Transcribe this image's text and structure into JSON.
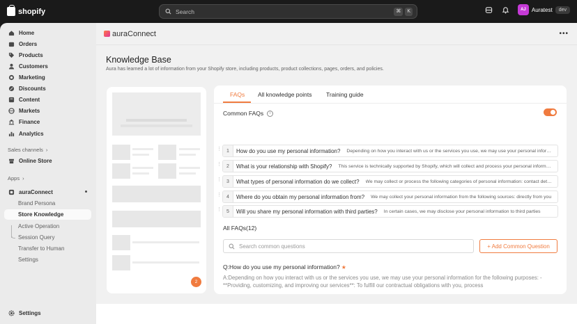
{
  "topbar": {
    "brand": "shopify",
    "search_placeholder": "Search",
    "shortcut_keys": [
      "⌘",
      "K"
    ],
    "store_initials": "AJ",
    "store_name": "Auratest",
    "store_tag": "dev"
  },
  "sidebar": {
    "items": [
      {
        "label": "Home",
        "icon": "home-icon"
      },
      {
        "label": "Orders",
        "icon": "orders-icon"
      },
      {
        "label": "Products",
        "icon": "tag-icon"
      },
      {
        "label": "Customers",
        "icon": "person-icon"
      },
      {
        "label": "Marketing",
        "icon": "target-icon"
      },
      {
        "label": "Discounts",
        "icon": "discount-icon"
      },
      {
        "label": "Content",
        "icon": "content-icon"
      },
      {
        "label": "Markets",
        "icon": "globe-icon"
      },
      {
        "label": "Finance",
        "icon": "bank-icon"
      },
      {
        "label": "Analytics",
        "icon": "chart-icon"
      }
    ],
    "sales_channels_label": "Sales channels",
    "online_store": "Online Store",
    "apps_label": "Apps",
    "app_name": "auraConnect",
    "app_subitems": [
      "Brand Persona",
      "Store Knowledge",
      "Active Operation",
      "Session Query",
      "Transfer to Human",
      "Settings"
    ],
    "active_subitem": "Store Knowledge",
    "settings": "Settings"
  },
  "app_header": {
    "title": "auraConnect"
  },
  "page": {
    "title": "Knowledge Base",
    "subtitle": "Aura has learned a lot of information from your Shopify store, including products, product collections, pages, orders, and policies."
  },
  "preview": {
    "badge_count": "2"
  },
  "tabs": [
    "FAQs",
    "All knowledge points",
    "Training guide"
  ],
  "common_faqs": {
    "title": "Common FAQs",
    "enabled": true,
    "items": [
      {
        "num": "1",
        "q": "How do you use my personal information?",
        "a": "Depending on how you interact with us or the services you use, we may use your personal information for the following purposes"
      },
      {
        "num": "2",
        "q": "What is your relationship with Shopify?",
        "a": "This service is technically supported by Shopify, which will collect and process your personal information"
      },
      {
        "num": "3",
        "q": "What types of personal information do we collect?",
        "a": "We may collect or process the following categories of personal information: contact details"
      },
      {
        "num": "4",
        "q": "Where do you obtain my personal information from?",
        "a": "We may collect your personal information from the following sources: directly from you"
      },
      {
        "num": "5",
        "q": "Will you share my personal information with third parties?",
        "a": "In certain cases, we may disclose your personal information to third parties"
      }
    ]
  },
  "all_faqs": {
    "title": "All FAQs(12)",
    "search_placeholder": "Search common questions",
    "add_button": "+ Add Common Question",
    "first_q": "Q:How do you use my personal information?",
    "first_a": "A:Depending on how you interact with us or the services you use, we may use your personal information for the following purposes: - **Providing, customizing, and improving our services**: To fulfill our contractual obligations with you, process"
  },
  "colors": {
    "accent": "#f07b3f",
    "topbar": "#1a1a1a",
    "sidebar": "#ebebeb",
    "avatar": "#c53ad6"
  }
}
